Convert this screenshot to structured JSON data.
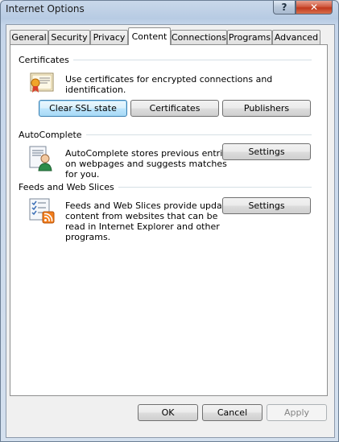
{
  "window": {
    "title": "Internet Options",
    "help_glyph": "?",
    "close_glyph": "✕"
  },
  "tabs": [
    {
      "label": "General"
    },
    {
      "label": "Security"
    },
    {
      "label": "Privacy"
    },
    {
      "label": "Content",
      "active": true
    },
    {
      "label": "Connections"
    },
    {
      "label": "Programs"
    },
    {
      "label": "Advanced"
    }
  ],
  "certificates": {
    "heading": "Certificates",
    "description": "Use certificates for encrypted connections and identification.",
    "icon": "certificate-icon",
    "buttons": {
      "clear_ssl": "Clear SSL state",
      "certificates": "Certificates",
      "publishers": "Publishers"
    }
  },
  "autocomplete": {
    "heading": "AutoComplete",
    "description_lines": [
      "AutoComplete stores previous entries",
      "on webpages and suggests matches",
      "for you."
    ],
    "icon": "autocomplete-user-icon",
    "settings": "Settings"
  },
  "feeds": {
    "heading": "Feeds and Web Slices",
    "description_lines": [
      "Feeds and Web Slices provide updated",
      "content from websites that can be",
      "read in Internet Explorer and other",
      "programs."
    ],
    "icon": "feeds-icon",
    "settings": "Settings"
  },
  "footer": {
    "ok": "OK",
    "cancel": "Cancel",
    "apply": "Apply"
  },
  "colors": {
    "focus_button": "#a7d9f5",
    "close_button": "#c0391d",
    "group_line": "#d5dfe5"
  }
}
